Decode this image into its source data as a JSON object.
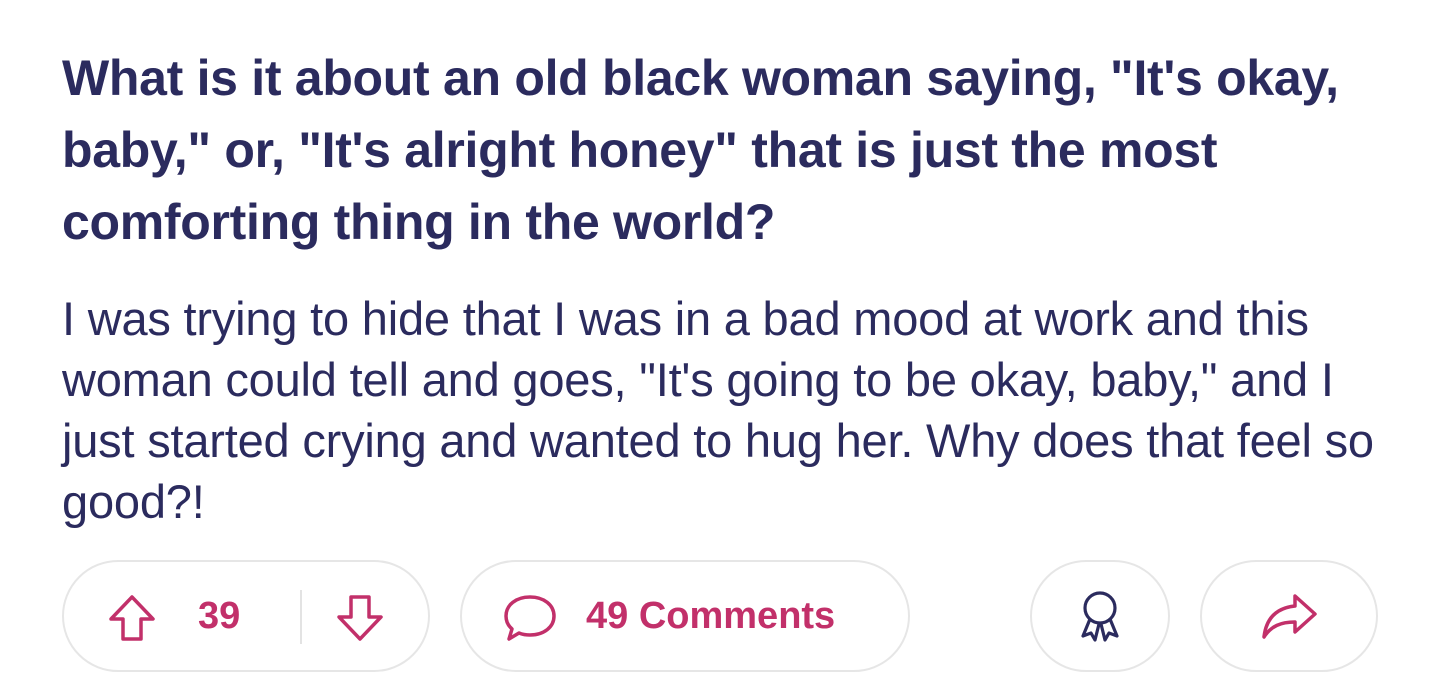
{
  "post": {
    "title": "What is it about an old black woman saying, \"It's okay, baby,\" or, \"It's alright honey\" that is just the most comforting thing in the world?",
    "body": "I was trying to hide that I was in a bad mood at work and this woman could tell and goes, \"It's going to be okay, baby,\" and I just started crying and wanted to hug her. Why does that feel so good?!"
  },
  "actions": {
    "vote_count": "39",
    "comments_label": "49 Comments",
    "icons": {
      "upvote": "arrow-up-icon",
      "downvote": "arrow-down-icon",
      "comment": "speech-bubble-icon",
      "award": "award-ribbon-icon",
      "share": "share-arrow-icon"
    }
  },
  "colors": {
    "text": "#2b2b5e",
    "accent": "#c2306a",
    "pill_border": "#e6e6e6"
  }
}
